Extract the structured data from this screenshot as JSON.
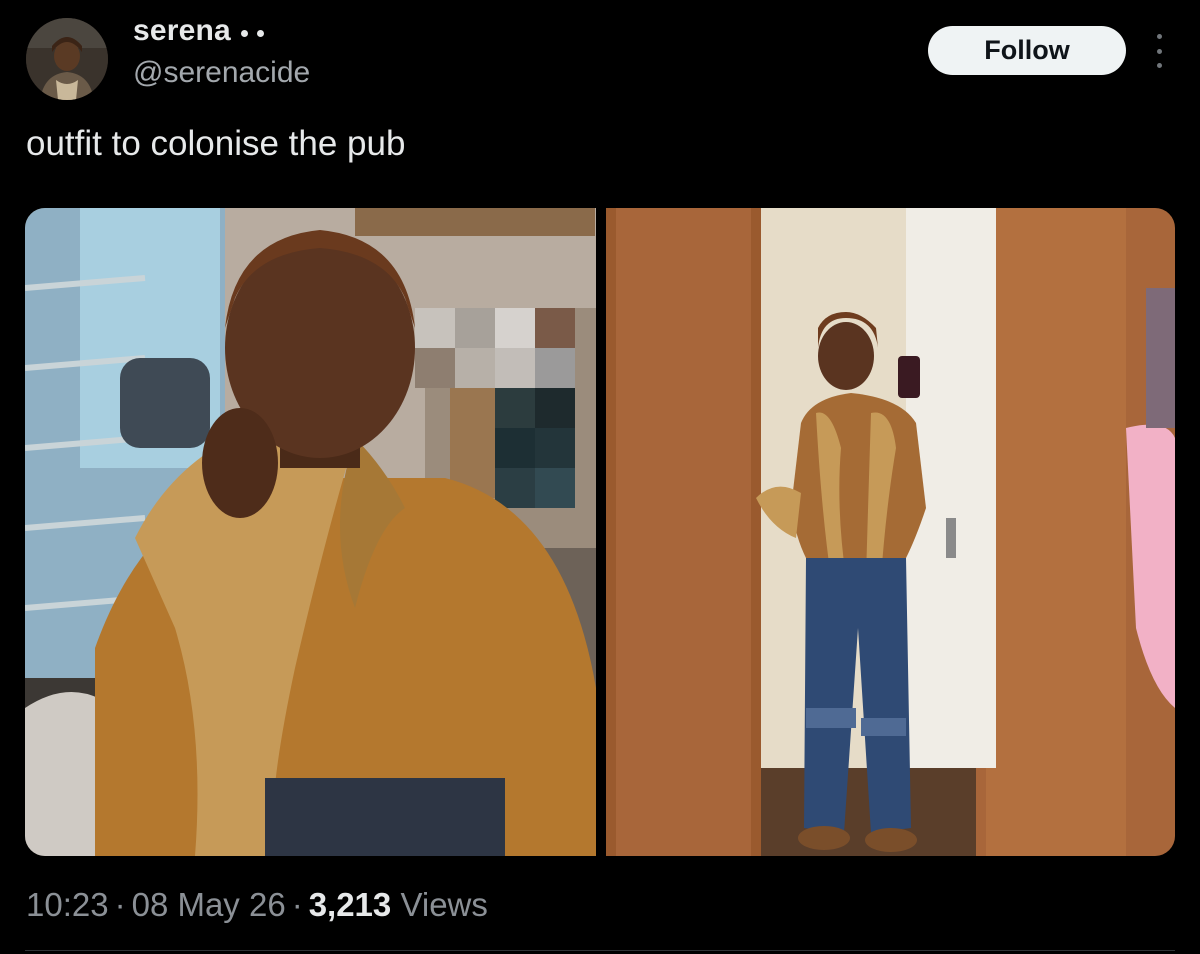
{
  "author": {
    "display_name": "serena",
    "handle": "@serenacide",
    "avatar_icon": "profile-photo"
  },
  "actions": {
    "follow_label": "Follow",
    "more_icon": "more-vertical-icon"
  },
  "tweet": {
    "text": "outfit to colonise the pub"
  },
  "media": {
    "photos": [
      {
        "icon": "photo-selfie-fur-cardigan"
      },
      {
        "icon": "photo-mirror-selfie-full-outfit"
      }
    ]
  },
  "meta": {
    "time": "10:23",
    "date": "08 May 26",
    "views_count": "3,213",
    "views_label": "Views"
  },
  "colors": {
    "background": "#000000",
    "text_primary": "#e7e9ea",
    "text_secondary": "#8b9096",
    "follow_button_bg": "#eff3f4"
  }
}
